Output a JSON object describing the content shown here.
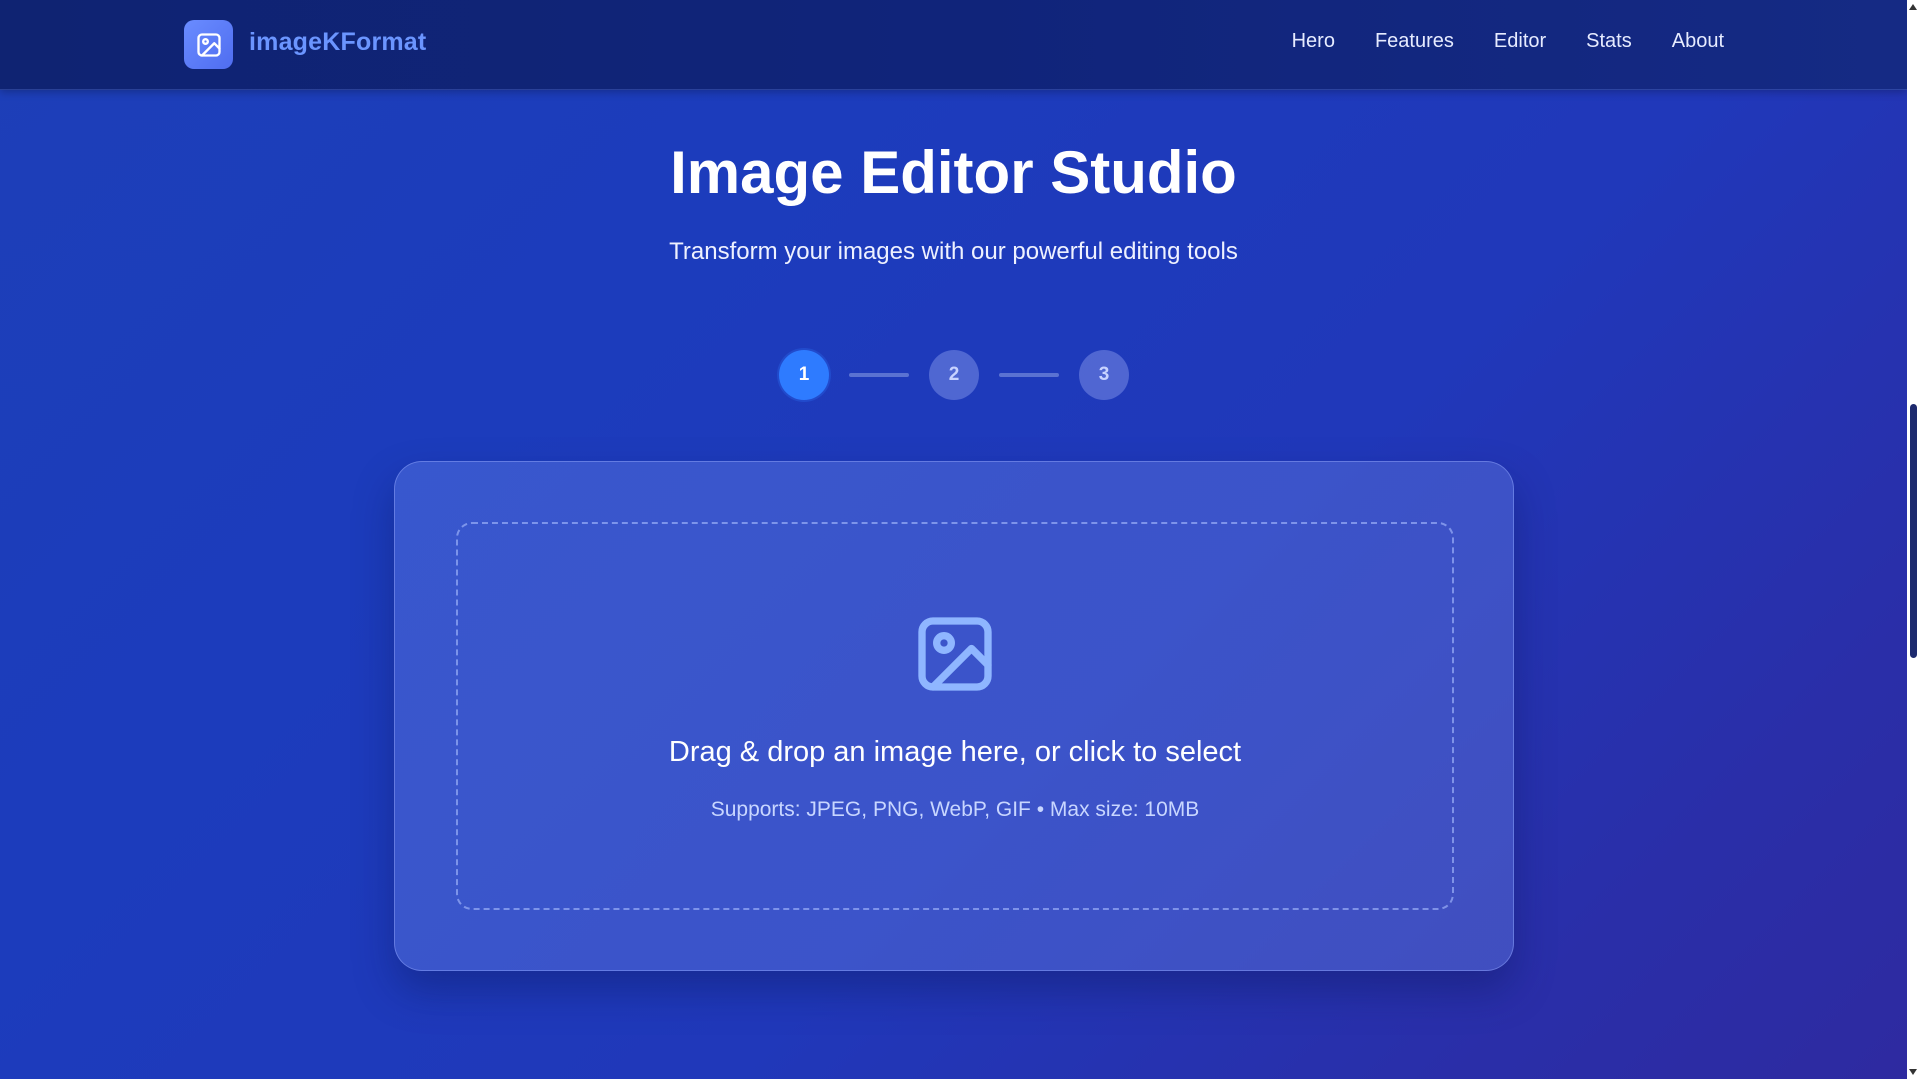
{
  "brand": {
    "name": "imageKFormat",
    "logo_icon": "image-icon"
  },
  "nav": {
    "items": [
      "Hero",
      "Features",
      "Editor",
      "Stats",
      "About"
    ]
  },
  "hero": {
    "title": "Image Editor Studio",
    "subtitle": "Transform your images with our powerful editing tools"
  },
  "steps": {
    "items": [
      "1",
      "2",
      "3"
    ],
    "active_index": 0
  },
  "upload": {
    "icon": "image-icon",
    "primary_text": "Drag & drop an image here, or click to select",
    "secondary_text": "Supports: JPEG, PNG, WebP, GIF • Max size: 10MB"
  },
  "colors": {
    "accent": "#2e7bff",
    "brand_text": "#6b95ff",
    "header_bg": "#0f2372"
  }
}
